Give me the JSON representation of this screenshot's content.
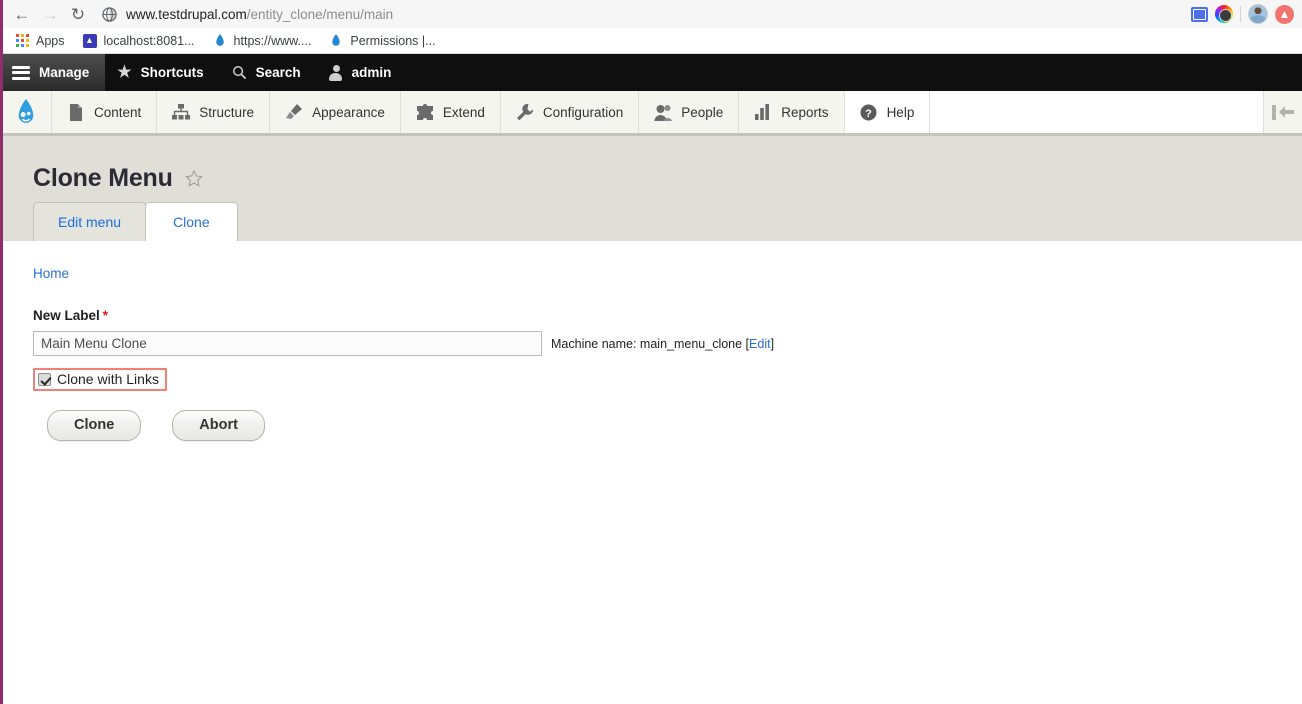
{
  "browser": {
    "back_icon": "back-arrow-icon",
    "forward_icon": "forward-arrow-icon",
    "reload_icon": "reload-icon",
    "site_icon": "globe-icon",
    "url_main": "www.testdrupal.com",
    "url_rest": "/entity_clone/menu/main",
    "url_full": "www.testdrupal.com/entity_clone/menu/main",
    "extensions": [
      {
        "name": "extension-icon-blue"
      },
      {
        "name": "extension-icon-rainbow"
      }
    ],
    "profile": {
      "name": "profile-avatar"
    },
    "update_icon": "update-arrow-icon",
    "bookmarks": [
      {
        "label": "Apps",
        "icon": "apps-grid-icon"
      },
      {
        "label": "localhost:8081...",
        "icon": "localhost-favicon"
      },
      {
        "label": "https://www....",
        "icon": "drupal-favicon"
      },
      {
        "label": "Permissions |...",
        "icon": "drupal-favicon"
      }
    ]
  },
  "admin_toolbar": {
    "items": [
      {
        "label": "Manage",
        "icon": "hamburger-icon",
        "active": true
      },
      {
        "label": "Shortcuts",
        "icon": "star-icon",
        "active": false
      },
      {
        "label": "Search",
        "icon": "search-icon",
        "active": false
      },
      {
        "label": "admin",
        "icon": "person-icon",
        "active": false
      }
    ]
  },
  "admin_menu": {
    "logo": "drupal-logo",
    "items": [
      {
        "label": "Content",
        "icon": "file-icon"
      },
      {
        "label": "Structure",
        "icon": "structure-icon"
      },
      {
        "label": "Appearance",
        "icon": "brush-icon"
      },
      {
        "label": "Extend",
        "icon": "puzzle-icon"
      },
      {
        "label": "Configuration",
        "icon": "wrench-icon"
      },
      {
        "label": "People",
        "icon": "people-icon"
      },
      {
        "label": "Reports",
        "icon": "bar-chart-icon"
      },
      {
        "label": "Help",
        "icon": "question-mark-icon"
      }
    ],
    "collapse_icon": "collapse-toolbar-icon"
  },
  "page": {
    "title": "Clone Menu",
    "favorite_icon": "star-outline-icon",
    "tabs": [
      {
        "label": "Edit menu",
        "active": false
      },
      {
        "label": "Clone",
        "active": true
      }
    ],
    "breadcrumb": "Home"
  },
  "form": {
    "label_text": "New Label",
    "required_marker": "*",
    "new_label_value": "Main Menu Clone",
    "new_label_placeholder": "",
    "machine_name_prefix": "Machine name: main_menu_clone [",
    "machine_name_edit": "Edit",
    "machine_name_suffix": "]",
    "checkbox_label": "Clone with Links",
    "checkbox_checked": true,
    "highlight_color": "#f18076",
    "submit_label": "Clone",
    "cancel_label": "Abort"
  }
}
